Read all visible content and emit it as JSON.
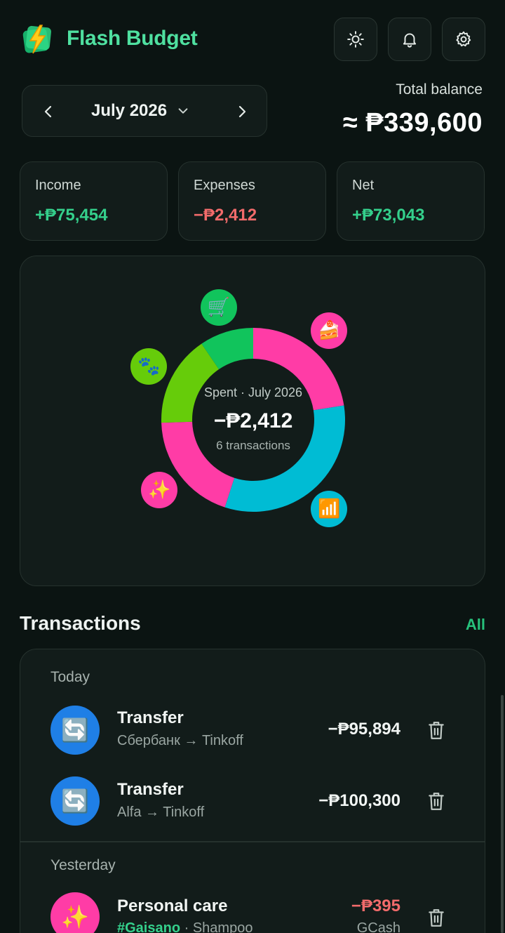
{
  "header": {
    "app_title": "Flash Budget",
    "logo_icon": "lightning-bolt-icon",
    "buttons": [
      "sun-icon",
      "bell-icon",
      "gear-icon"
    ]
  },
  "month_selector": {
    "label": "July 2026",
    "prev_icon": "chevron-left-icon",
    "next_icon": "chevron-right-icon",
    "dropdown_icon": "chevron-down-icon"
  },
  "balance": {
    "label": "Total balance",
    "value": "≈ ₱339,600"
  },
  "summary": {
    "income_label": "Income",
    "income_value": "+₱75,454",
    "expenses_label": "Expenses",
    "expenses_value": "−₱2,412",
    "net_label": "Net",
    "net_value": "+₱73,043"
  },
  "spending": {
    "center_title": "Spent · July 2026",
    "center_amount": "−₱2,412",
    "center_count": "6 transactions",
    "segments": [
      {
        "emoji": "🍰",
        "color": "#ff3ca6",
        "share": 0.225
      },
      {
        "emoji": "📶",
        "color": "#00bcd4",
        "share": 0.325
      },
      {
        "emoji": "✨",
        "color": "#ff3ca6",
        "share": 0.195
      },
      {
        "emoji": "🐾",
        "color": "#66cc0a",
        "share": 0.16
      },
      {
        "emoji": "🛒",
        "color": "#11c45c",
        "share": 0.095
      }
    ]
  },
  "transactions": {
    "title": "Transactions",
    "all_label": "All",
    "groups": [
      {
        "label": "Today",
        "items": [
          {
            "emoji": "🔄",
            "icon_bg": "#1f7fe6",
            "name": "Transfer",
            "sub": "Сбербанк → Tinkoff",
            "amount": "−₱95,894"
          },
          {
            "emoji": "🔄",
            "icon_bg": "#1f7fe6",
            "name": "Transfer",
            "sub": "Alfa → Tinkoff",
            "amount": "−₱100,300"
          }
        ]
      },
      {
        "label": "Yesterday",
        "items": [
          {
            "emoji": "✨",
            "icon_bg": "#ff3ca6",
            "name": "Personal care",
            "tag": "#Gaisano",
            "sub": " · Shampoo",
            "amount": "−₱395",
            "account": "GCash"
          }
        ]
      }
    ]
  }
}
